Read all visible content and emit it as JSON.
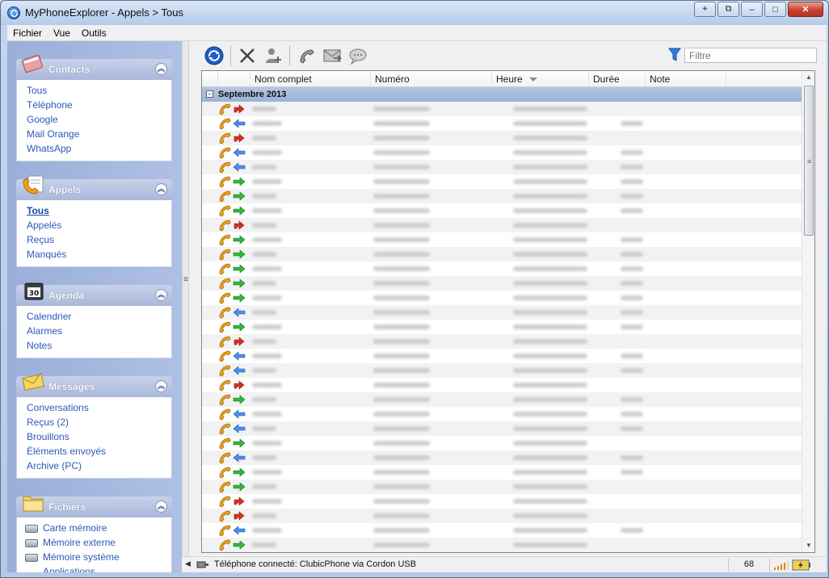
{
  "window": {
    "title": "MyPhoneExplorer -  Appels > Tous",
    "controls": [
      "⌖",
      "⧉",
      "–",
      "□",
      "✕"
    ]
  },
  "menu": [
    "Fichier",
    "Vue",
    "Outils"
  ],
  "sidebar": {
    "groups": [
      {
        "title": "Contacts",
        "icon": "contacts-book-icon",
        "items": [
          "Tous",
          "Téléphone",
          "Google",
          "Mail Orange",
          "WhatsApp"
        ]
      },
      {
        "title": "Appels",
        "icon": "calls-icon",
        "items": [
          "Tous",
          "Appelés",
          "Reçus",
          "Manqués"
        ],
        "active": "Tous"
      },
      {
        "title": "Agenda",
        "icon": "agenda-icon",
        "items": [
          "Calendrier",
          "Alarmes",
          "Notes"
        ]
      },
      {
        "title": "Messages",
        "icon": "envelope-icon",
        "items": [
          "Conversations",
          "Reçus (2)",
          "Brouillons",
          "Éléments envoyés",
          "Archive (PC)"
        ]
      },
      {
        "title": "Fichiers",
        "icon": "folder-icon",
        "items": [
          "Carte mémoire",
          "Mémoire externe",
          "Mémoire système",
          "Applications"
        ]
      }
    ]
  },
  "toolbar": {
    "buttons": [
      "refresh-icon",
      "delete-icon",
      "add-contact-icon",
      "call-icon",
      "message-icon",
      "chat-icon"
    ],
    "filter_placeholder": "Filtre"
  },
  "grid": {
    "columns": [
      "",
      "Nom complet",
      "Numéro",
      "Heure",
      "Durée",
      "Note"
    ],
    "sort_column": "Heure",
    "group_label": "Septembre 2013",
    "group_toggle": "−",
    "rows": [
      {
        "dir": "missed",
        "dur": false
      },
      {
        "dir": "in",
        "dur": true
      },
      {
        "dir": "missed",
        "dur": false
      },
      {
        "dir": "in",
        "dur": true
      },
      {
        "dir": "in",
        "dur": true
      },
      {
        "dir": "out",
        "dur": true
      },
      {
        "dir": "out",
        "dur": true
      },
      {
        "dir": "out",
        "dur": true
      },
      {
        "dir": "missed",
        "dur": false
      },
      {
        "dir": "out",
        "dur": true
      },
      {
        "dir": "out",
        "dur": true
      },
      {
        "dir": "out",
        "dur": true
      },
      {
        "dir": "out",
        "dur": true
      },
      {
        "dir": "out",
        "dur": true
      },
      {
        "dir": "in",
        "dur": true
      },
      {
        "dir": "out",
        "dur": true
      },
      {
        "dir": "missed",
        "dur": false
      },
      {
        "dir": "in",
        "dur": true
      },
      {
        "dir": "in",
        "dur": true
      },
      {
        "dir": "missed",
        "dur": false
      },
      {
        "dir": "out",
        "dur": true
      },
      {
        "dir": "in",
        "dur": true
      },
      {
        "dir": "in",
        "dur": true
      },
      {
        "dir": "out",
        "dur": false
      },
      {
        "dir": "in",
        "dur": true
      },
      {
        "dir": "out",
        "dur": true
      },
      {
        "dir": "out",
        "dur": false
      },
      {
        "dir": "missed",
        "dur": false
      },
      {
        "dir": "missed",
        "dur": false
      },
      {
        "dir": "in",
        "dur": true
      },
      {
        "dir": "out",
        "dur": false
      }
    ]
  },
  "status": {
    "connection": "Téléphone connecté: ClubicPhone via Cordon USB",
    "count": "68"
  },
  "colors": {
    "accent": "#2b59b7",
    "missed": "#d93025",
    "incoming": "#4a8ff0",
    "outgoing": "#2fb83a",
    "phone": "#f0a21c"
  }
}
